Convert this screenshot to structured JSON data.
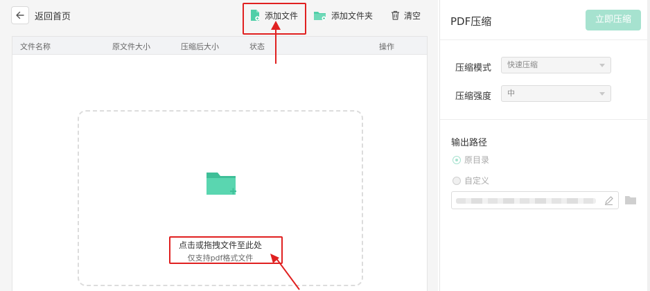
{
  "toolbar": {
    "back_label": "返回首页",
    "add_file": "添加文件",
    "add_folder": "添加文件夹",
    "clear": "清空"
  },
  "table": {
    "headers": [
      "文件名称",
      "原文件大小",
      "压缩后大小",
      "状态",
      "操作"
    ]
  },
  "dropzone": {
    "main_text": "点击或拖拽文件至此处",
    "sub_text": "仅支持pdf格式文件"
  },
  "panel": {
    "title": "PDF压缩",
    "start_button": "立即压缩",
    "mode_label": "压缩模式",
    "mode_value": "快速压缩",
    "strength_label": "压缩强度",
    "strength_value": "中",
    "output_label": "输出路径",
    "option_original": "原目录",
    "option_custom": "自定义"
  },
  "colors": {
    "accent": "#4fcfa8",
    "accent_disabled": "#a6e2cf",
    "annotation_red": "#e02020"
  },
  "icons": [
    "back-arrow-icon",
    "add-file-icon",
    "add-folder-icon",
    "trash-icon",
    "folder-add-icon",
    "edit-icon",
    "folder-icon"
  ]
}
